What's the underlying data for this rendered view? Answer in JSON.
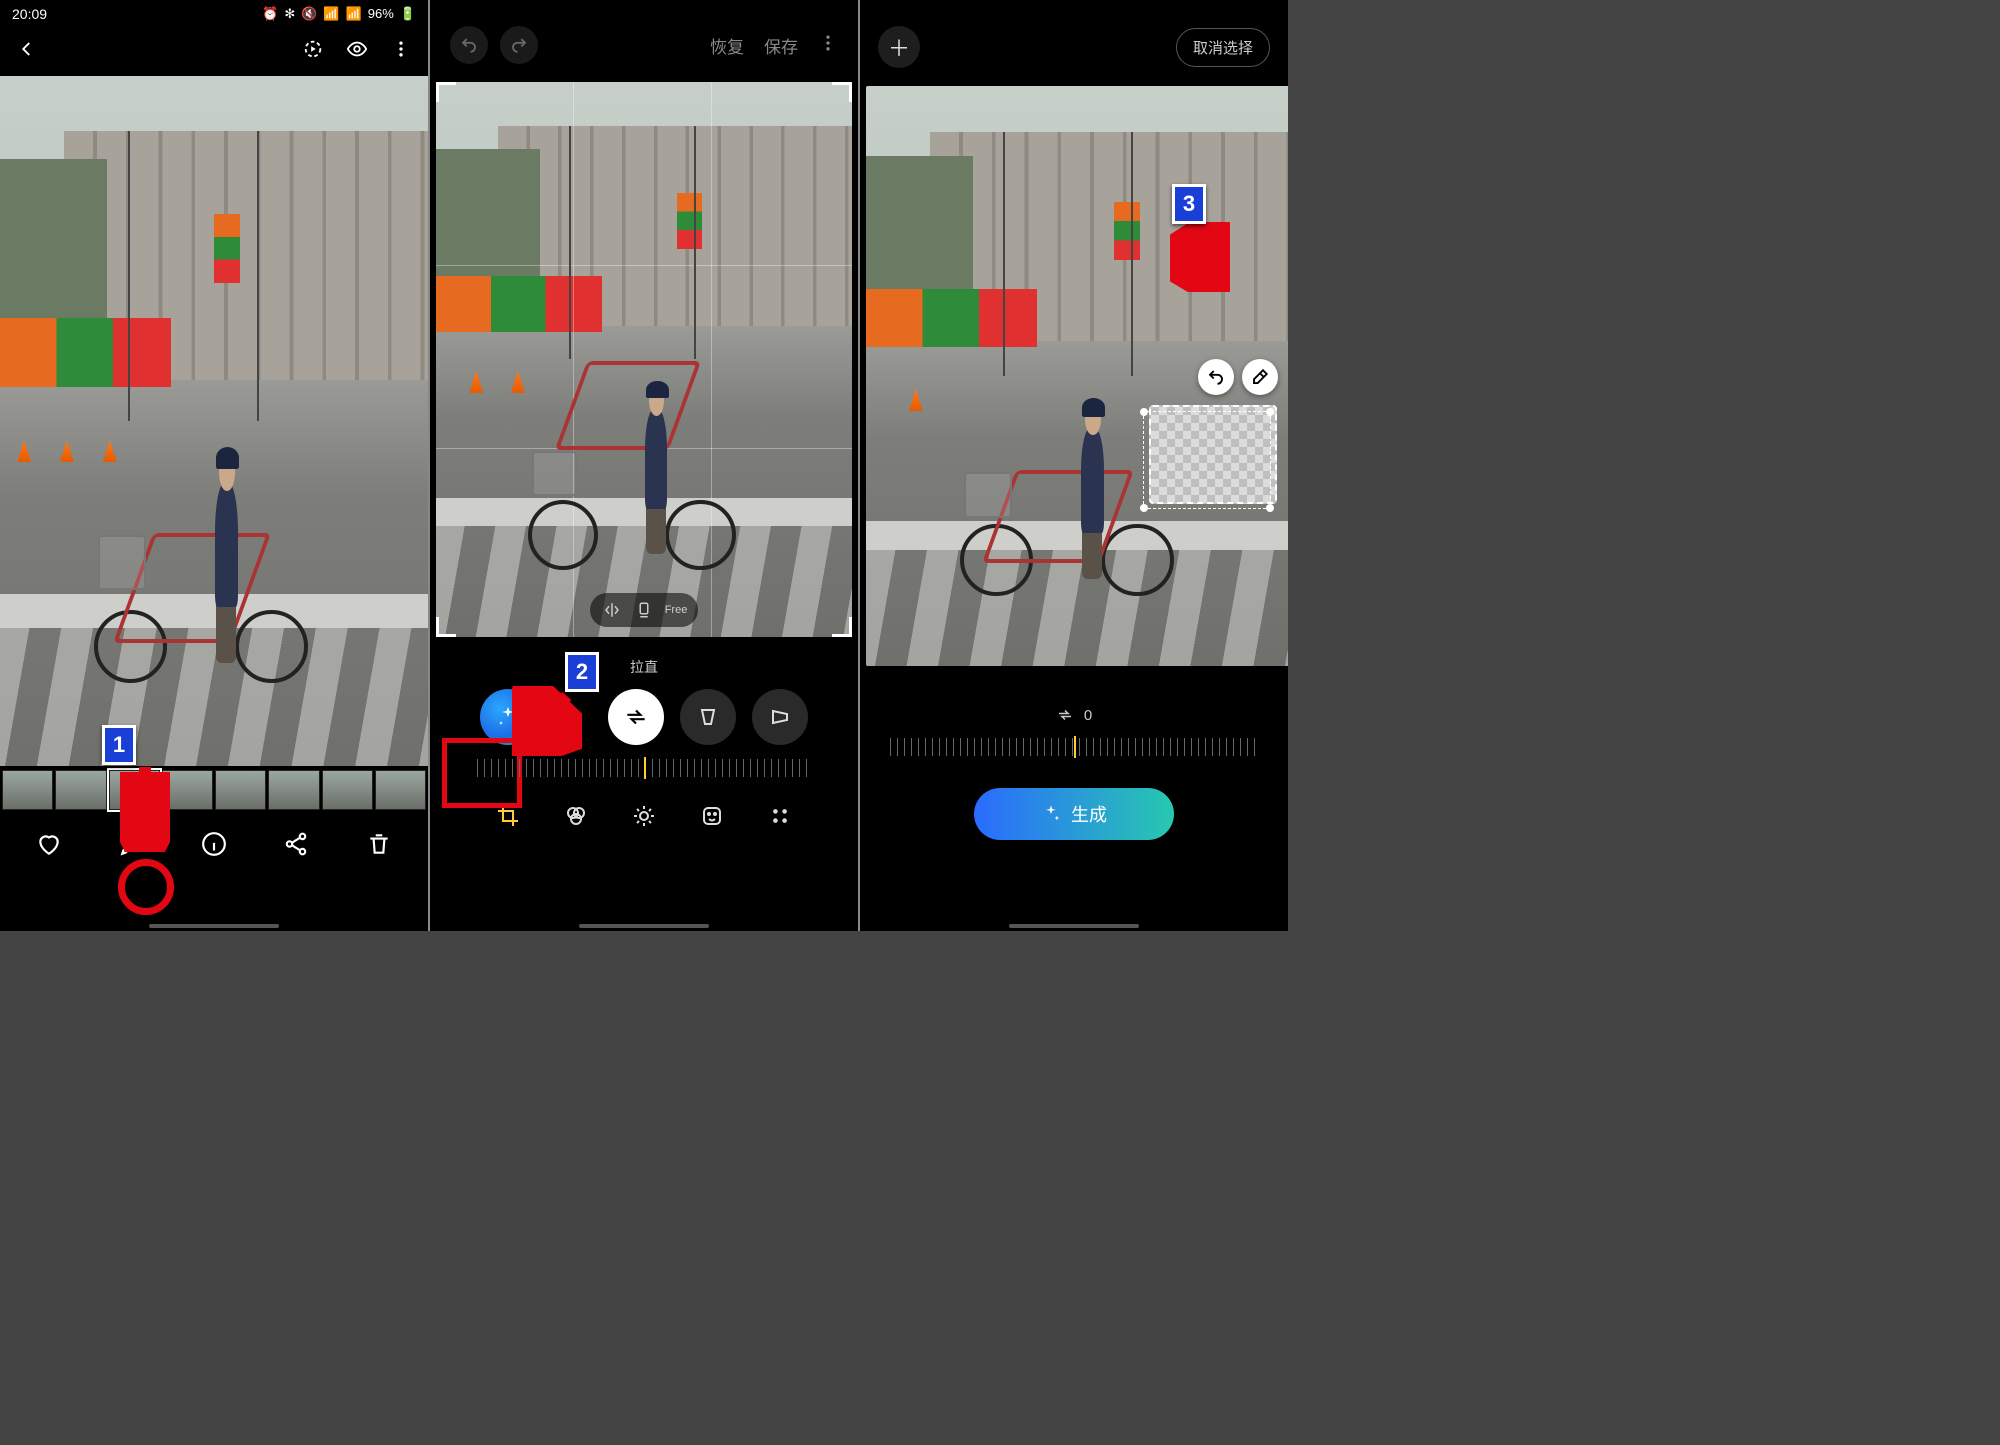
{
  "status": {
    "time": "20:09",
    "battery": "96%"
  },
  "screen1": {
    "bottom_icons": [
      "heart",
      "edit",
      "info",
      "share",
      "delete"
    ]
  },
  "screen2": {
    "top": {
      "restore": "恢复",
      "save": "保存"
    },
    "ratio_free": "Free",
    "straighten_label": "拉直",
    "tools": [
      "crop",
      "filter",
      "adjust",
      "sticker",
      "more"
    ]
  },
  "screen3": {
    "cancel_selection": "取消选择",
    "straighten_value": "0",
    "generate": "生成"
  },
  "steps": {
    "s1": "1",
    "s2": "2",
    "s3": "3"
  }
}
